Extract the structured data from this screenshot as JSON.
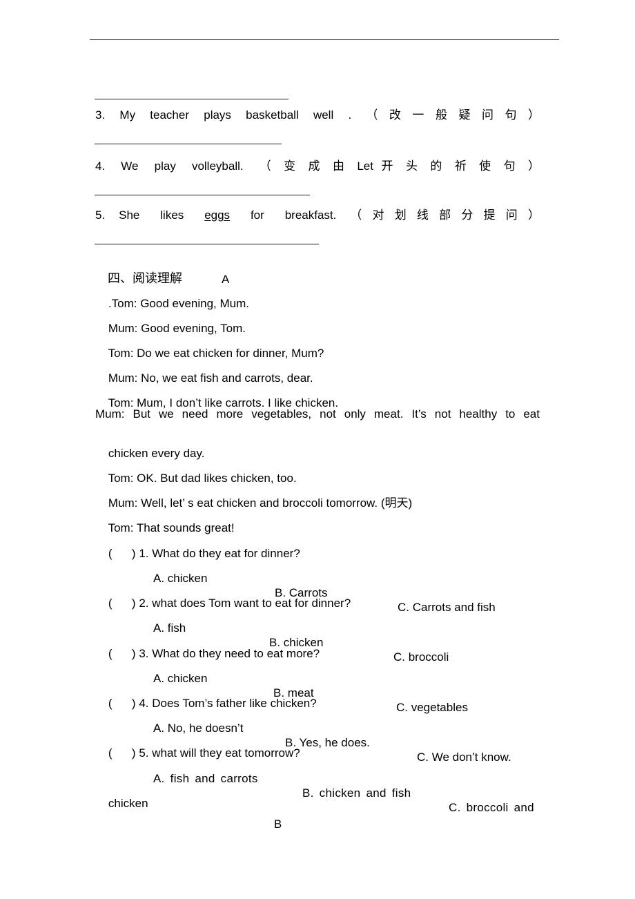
{
  "document": {
    "type": "english-exam-worksheet",
    "language": "en-zh"
  },
  "sentence_transform": {
    "items": [
      {
        "number": "3.",
        "english": "My   teacher   plays   basketball   well   .",
        "instruction": "（ 改 一 般 疑 问 句 ）",
        "full": "3.  My  teacher  plays  basketball  well  .  （ 改 一 般 疑 问 句 ）"
      },
      {
        "number": "4.",
        "english": "We   play   volleyball.",
        "instruction": "（ 变 成 由 Let 开 头 的 祈 使 句 ）",
        "full": "4.  We  play  volleyball.  （ 变 成 由 Let 开 头 的 祈 使 句 ）"
      },
      {
        "number": "5.",
        "english_before": "She   likes   ",
        "underlined": "eggs",
        "english_after": "   for   breakfast.",
        "instruction": "（ 对 划 线 部 分 提 问 ）",
        "full": "5.  She  likes  eggs  for  breakfast.  （ 对 划 线 部 分 提 问 ）"
      }
    ]
  },
  "section": {
    "heading_cn": "四、阅读理解",
    "passage_label": "A",
    "passage_label_b": "B"
  },
  "dialogue": {
    "lines": [
      ".Tom: Good evening, Mum.",
      "Mum: Good evening, Tom.",
      "Tom: Do we eat chicken for dinner, Mum?",
      "Mum: No, we eat fish and carrots, dear.",
      "Tom: Mum, I don’t like carrots. I like chicken."
    ],
    "wrapped_line": {
      "part1": "Mum: But we need more vegetables, not only meat. It’s not healthy to eat",
      "part2": "chicken every day."
    },
    "lines_after": [
      "Tom: OK. But dad likes chicken, too.",
      "Mum: Well, let’ s eat chicken and broccoli tomorrow. (明天)",
      "Tom: That sounds great!"
    ]
  },
  "questions": [
    {
      "bracket_open": "(",
      "bracket_close": ")",
      "number": "1.",
      "text": "What do they eat for dinner?",
      "prompt": "( \t ) 1. What do they eat for dinner?",
      "options": [
        {
          "letter": "A.",
          "label": "chicken",
          "text": "A. chicken"
        },
        {
          "letter": "B.",
          "label": "Carrots",
          "text": "B. Carrots"
        },
        {
          "letter": "C.",
          "label": "Carrots and fish",
          "text": "C. Carrots and fish"
        }
      ]
    },
    {
      "bracket_open": "(",
      "bracket_close": ")",
      "number": "2.",
      "text": "what does Tom want to eat for dinner?",
      "prompt": "( \t ) 2. what does Tom want to eat for dinner?",
      "options": [
        {
          "letter": "A.",
          "label": "fish",
          "text": "A. fish"
        },
        {
          "letter": "B.",
          "label": "chicken",
          "text": "B. chicken"
        },
        {
          "letter": "C.",
          "label": "broccoli",
          "text": "C. broccoli"
        }
      ]
    },
    {
      "bracket_open": "(",
      "bracket_close": ")",
      "number": "3.",
      "text": "What do they need to eat more?",
      "prompt": "( \t ) 3. What do they need to eat more?",
      "options": [
        {
          "letter": "A.",
          "label": "chicken",
          "text": "A. chicken"
        },
        {
          "letter": "B.",
          "label": "meat",
          "text": "B. meat"
        },
        {
          "letter": "C.",
          "label": "vegetables",
          "text": "C. vegetables"
        }
      ]
    },
    {
      "bracket_open": "(",
      "bracket_close": ")",
      "number": "4.",
      "text": "Does Tom’s father like chicken?",
      "prompt": "( \t ) 4. Does Tom’s father like chicken?",
      "options": [
        {
          "letter": "A.",
          "label": "No, he doesn’t",
          "text": "A. No, he doesn’t"
        },
        {
          "letter": "B.",
          "label": "Yes, he does.",
          "text": "B. Yes, he does."
        },
        {
          "letter": "C.",
          "label": "We don’t know.",
          "text": "C. We don’t know."
        }
      ]
    },
    {
      "bracket_open": "(",
      "bracket_close": ")",
      "number": "5.",
      "text": "what will they eat tomorrow?",
      "prompt": "( \t ) 5. what will they eat tomorrow?",
      "options": [
        {
          "letter": "A.",
          "label": "fish and carrots",
          "text": "A. fish and carrots"
        },
        {
          "letter": "B.",
          "label": "chicken and fish",
          "text": "B. chicken and fish"
        },
        {
          "letter": "C.",
          "label": "broccoli and",
          "text": "C. broccoli and"
        }
      ],
      "option_wrap": "chicken"
    }
  ],
  "colors": {
    "text": "#000000",
    "rule": "#1a1a1a",
    "page_rule": "#3a3a3a",
    "background": "#ffffff"
  }
}
